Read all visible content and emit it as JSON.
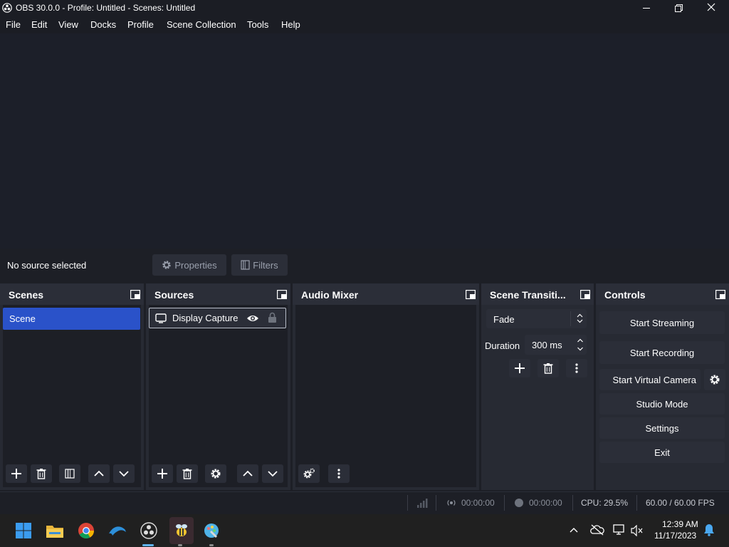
{
  "window": {
    "title": "OBS 30.0.0 - Profile: Untitled - Scenes: Untitled"
  },
  "menu": [
    "File",
    "Edit",
    "View",
    "Docks",
    "Profile",
    "Scene Collection",
    "Tools",
    "Help"
  ],
  "context": {
    "no_source": "No source selected",
    "properties_label": "Properties",
    "filters_label": "Filters"
  },
  "scenes": {
    "title": "Scenes",
    "items": [
      "Scene"
    ]
  },
  "sources": {
    "title": "Sources",
    "items": [
      "Display Capture"
    ]
  },
  "audio_mixer": {
    "title": "Audio Mixer"
  },
  "transitions": {
    "title": "Scene Transiti...",
    "selected": "Fade",
    "duration_label": "Duration",
    "duration_value": "300 ms"
  },
  "controls": {
    "title": "Controls",
    "start_streaming": "Start Streaming",
    "start_recording": "Start Recording",
    "start_virtual_camera": "Start Virtual Camera",
    "studio_mode": "Studio Mode",
    "settings": "Settings",
    "exit": "Exit"
  },
  "status": {
    "stream_time": "00:00:00",
    "record_time": "00:00:00",
    "cpu": "CPU: 29.5%",
    "fps": "60.00 / 60.00 FPS"
  },
  "taskbar": {
    "time": "12:39 AM",
    "date": "11/17/2023"
  },
  "colors": {
    "accent": "#2a52c9",
    "panel": "#272a33",
    "dock_header": "#2b2e38",
    "background": "#1d1f26"
  }
}
